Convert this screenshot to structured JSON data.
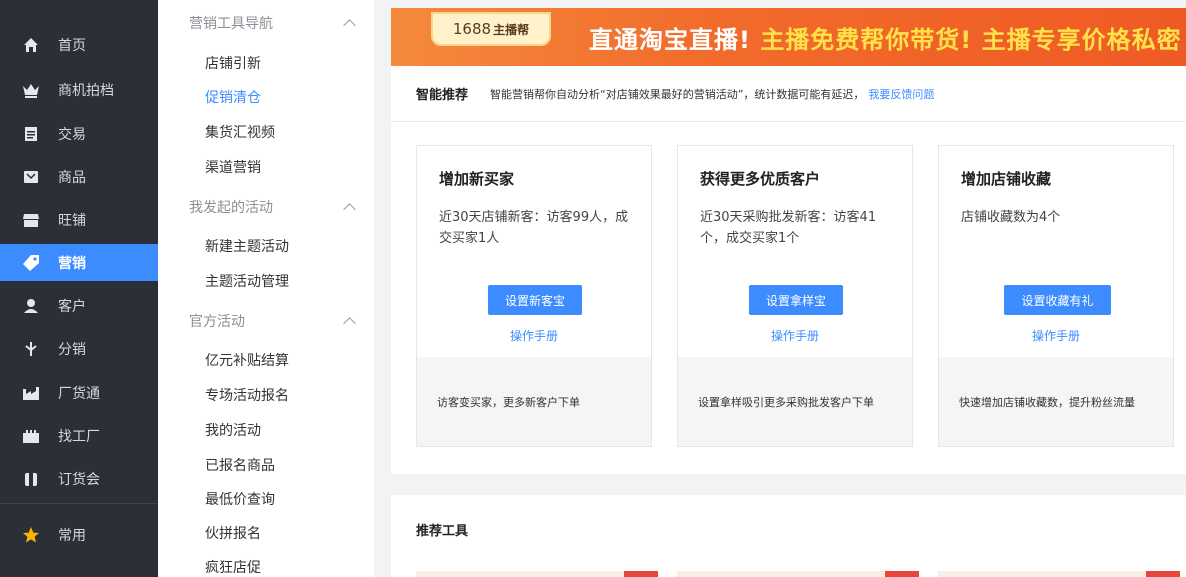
{
  "left_nav": {
    "items": [
      {
        "label": "首页",
        "icon": "home-icon"
      },
      {
        "label": "商机拍档",
        "icon": "crown-icon"
      },
      {
        "label": "交易",
        "icon": "clipboard-icon"
      },
      {
        "label": "商品",
        "icon": "box-icon"
      },
      {
        "label": "旺铺",
        "icon": "store-icon"
      },
      {
        "label": "营销",
        "icon": "tag-icon",
        "active": true
      },
      {
        "label": "客户",
        "icon": "user-icon"
      },
      {
        "label": "分销",
        "icon": "share-icon"
      },
      {
        "label": "厂货通",
        "icon": "factory-icon"
      },
      {
        "label": "找工厂",
        "icon": "building-icon"
      },
      {
        "label": "订货会",
        "icon": "order-icon"
      },
      {
        "label": "常用",
        "icon": "star-icon"
      }
    ]
  },
  "sub_menu": {
    "group1": {
      "title": "营销工具导航",
      "links": [
        "店铺引新",
        "促销清仓",
        "集货汇视频",
        "渠道营销"
      ]
    },
    "group2": {
      "title": "我发起的活动",
      "links": [
        "新建主题活动",
        "主题活动管理"
      ]
    },
    "group3": {
      "title": "官方活动",
      "links": [
        "亿元补贴结算",
        "专场活动报名",
        "我的活动",
        "已报名商品",
        "最低价查询",
        "伙拼报名",
        "疯狂店促"
      ]
    },
    "active_link": "促销清仓"
  },
  "banner": {
    "badge": "1688",
    "badge_suffix": "主播帮",
    "headline_a": "直通淘宝直播!",
    "headline_b": "主播免费帮你带货!",
    "headline_c": "主播专享价格私密"
  },
  "smart": {
    "title": "智能推荐",
    "description": "智能营销帮你自动分析“对店铺效果最好的营销活动”，统计数据可能有延迟，",
    "feedback_link": "我要反馈问题",
    "cards": [
      {
        "title": "增加新买家",
        "stat": "近30天店铺新客：访客99人，成交买家1人",
        "button": "设置新客宝",
        "manual": "操作手册",
        "footer": "访客变买家，更多新客户下单"
      },
      {
        "title": "获得更多优质客户",
        "stat": "近30天采购批发新客：访客41个，成交买家1个",
        "button": "设置拿样宝",
        "manual": "操作手册",
        "footer": "设置拿样吸引更多采购批发客户下单"
      },
      {
        "title": "增加店铺收藏",
        "stat": "店铺收藏数为4个",
        "button": "设置收藏有礼",
        "manual": "操作手册",
        "footer": "快速增加店铺收藏数，提升粉丝流量"
      }
    ]
  },
  "tools": {
    "title": "推荐工具"
  },
  "colors": {
    "accent": "#3c8cff",
    "nav_bg": "#2b2f38",
    "banner_orange": "#f26b2b",
    "star": "#f7b500"
  }
}
